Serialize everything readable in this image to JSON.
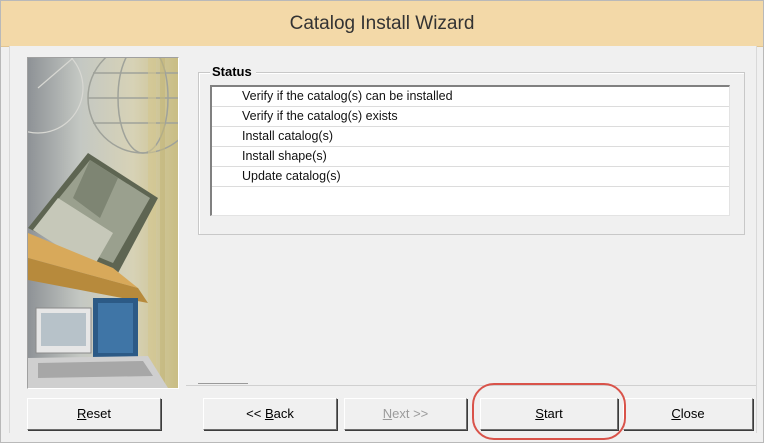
{
  "window": {
    "title": "Catalog Install Wizard",
    "title_bg": "#f3d9a8"
  },
  "status": {
    "label": "Status",
    "items": [
      "Verify if the catalog(s) can be installed",
      "Verify if the catalog(s) exists",
      "Install catalog(s)",
      "Install shape(s)",
      "Update catalog(s)"
    ]
  },
  "buttons": {
    "reset": {
      "accel": "R",
      "rest": "eset"
    },
    "back": {
      "pre": "<< ",
      "accel": "B",
      "rest": "ack"
    },
    "next": {
      "accel": "N",
      "rest": "ext >>"
    },
    "start": {
      "accel": "S",
      "rest": "tart"
    },
    "close": {
      "accel": "C",
      "rest": "lose"
    }
  },
  "annotation": {
    "highlight_color": "#d9534a",
    "highlighted": "start-button"
  },
  "icons": [
    "book-illustration",
    "globe-illustration",
    "computer-illustration"
  ]
}
